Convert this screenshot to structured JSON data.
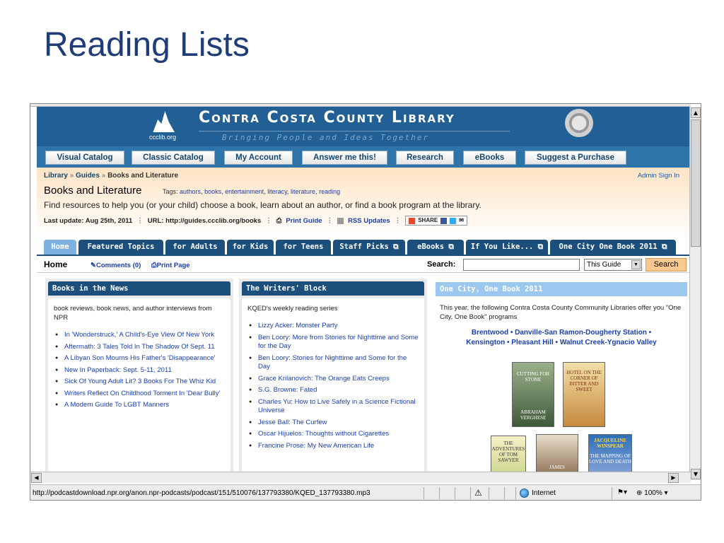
{
  "slide": {
    "title": "Reading Lists"
  },
  "library": {
    "logo_text": "ccclib.org",
    "title": "Contra Costa County Library",
    "tagline": "Bringing People and Ideas Together"
  },
  "topnav": [
    "Visual Catalog",
    "Classic Catalog",
    "My Account",
    "Answer me this!",
    "Research",
    "eBooks",
    "Suggest a Purchase"
  ],
  "breadcrumb": {
    "library": "Library",
    "guides": "Guides",
    "current": "Books and Literature",
    "sep": "»"
  },
  "admin_link": "Admin Sign In",
  "guide": {
    "title": "Books and Literature",
    "tags_label": "Tags:",
    "tags": [
      "authors",
      "books",
      "entertainment",
      "literacy",
      "literature",
      "reading"
    ],
    "description": "Find resources to help you (or your child) choose a book, learn about an author, or find a book program at the library.",
    "last_update": "Last update: Aug 25th, 2011",
    "url": "URL: http://guides.ccclib.org/books",
    "print_guide": "Print Guide",
    "rss": "RSS Updates",
    "share": "SHARE"
  },
  "guide_tabs": [
    {
      "label": "Home",
      "active": true
    },
    {
      "label": "Featured Topics",
      "active": false
    },
    {
      "label": "for Adults",
      "active": false
    },
    {
      "label": "for Kids",
      "active": false
    },
    {
      "label": "for Teens",
      "active": false
    },
    {
      "label": "Staff Picks ⧉",
      "active": false
    },
    {
      "label": "eBooks ⧉",
      "active": false
    },
    {
      "label": "If You Like... ⧉",
      "active": false
    },
    {
      "label": "One City One Book 2011 ⧉",
      "active": false
    }
  ],
  "pagebar": {
    "home": "Home",
    "comments": "Comments (0)",
    "print_page": "Print Page",
    "search_label": "Search:",
    "search_value": "",
    "scope": "This Guide",
    "search_button": "Search"
  },
  "books_news": {
    "header": "Books in the News",
    "intro": "book reviews, book news, and author interviews from NPR",
    "items": [
      "In 'Wonderstruck,' A Child's-Eye View Of New York",
      "Aftermath: 3 Tales Told In The Shadow Of Sept. 11",
      "A Libyan Son Mourns His Father's 'Disappearance'",
      "New In Paperback: Sept. 5-11, 2011",
      "Sick Of Young Adult Lit? 3 Books For The Whiz Kid",
      "Writers Reflect On Childhood Torment In 'Dear Bully'",
      "A Modern Guide To LGBT Manners"
    ]
  },
  "writers_block": {
    "header": "The Writers' Block",
    "intro": "KQED's weekly reading series",
    "items": [
      "Lizzy Acker: Monster Party",
      "Ben Loory: More from Stories for Nighttime and Some for the Day",
      "Ben Loory: Stories for Nighttime and Some for the Day",
      "Grace Krilanovich: The Orange Eats Creeps",
      "S.G. Browne: Fated",
      "Charles Yu: How to Live Safely in a Science Fictional Universe",
      "Jesse Ball: The Curfew",
      "Oscar Hijuelos: Thoughts without Cigarettes",
      "Francine Prose: My New American Life"
    ]
  },
  "one_city": {
    "header": "One City, One Book 2011",
    "intro": "This year, the following Contra Costa County Community Libraries offer you \"One City, One Book\" programs",
    "cities_line1": "Brentwood • Danville-San Ramon-Dougherty Station •",
    "cities_line2": "Kensington • Pleasant Hill • Walnut Creek-Ygnacio Valley",
    "books": [
      {
        "title": "CUTTING FOR STONE",
        "author": "ABRAHAM VERGHESE"
      },
      {
        "title": "HOTEL ON THE CORNER OF BITTER AND SWEET",
        "author": ""
      },
      {
        "title": "THE ADVENTURES OF TOM SAWYER",
        "author": ""
      },
      {
        "title": "JAMES",
        "author": ""
      },
      {
        "title": "THE MAPPING OF LOVE AND DEATH",
        "author": "JACQUELINE WINSPEAR"
      }
    ]
  },
  "status": {
    "url": "http://podcastdownload.npr.org/anon.npr-podcasts/podcast/151/510076/137793380/KQED_137793380.mp3",
    "zone": "Internet",
    "zoom": "100%"
  },
  "colors": {
    "title_blue": "#1f3c78",
    "banner": "#215f94",
    "tab_dark": "#1c4f7c",
    "accent_orange": "#fbc98f"
  }
}
